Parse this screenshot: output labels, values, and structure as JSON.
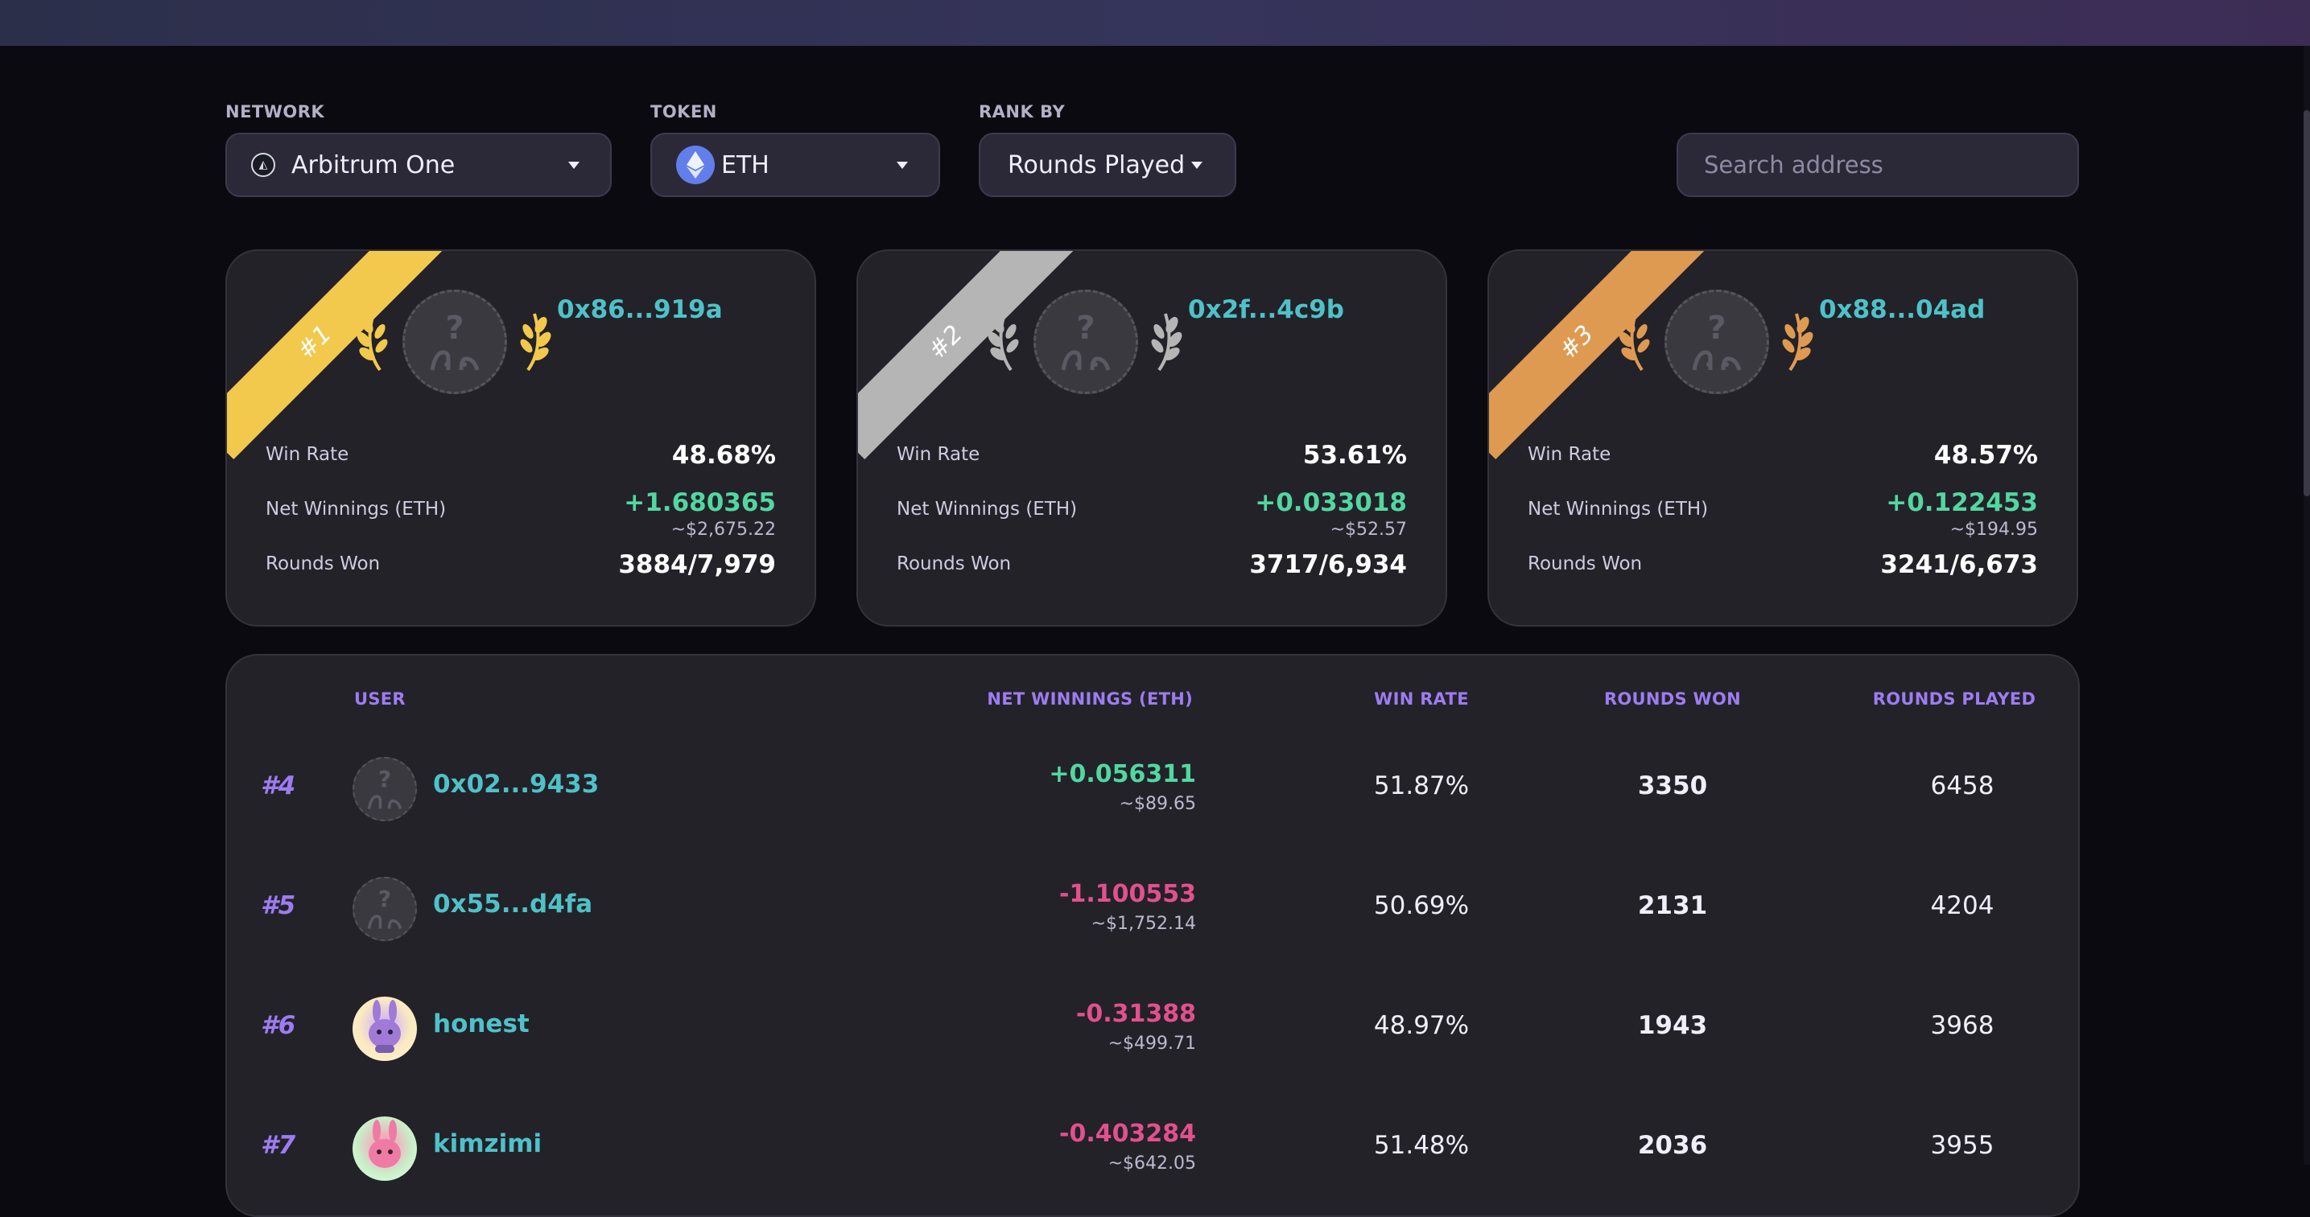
{
  "filters": {
    "network_label": "NETWORK",
    "network_value": "Arbitrum One",
    "token_label": "TOKEN",
    "token_value": "ETH",
    "rank_label": "RANK BY",
    "rank_value": "Rounds Played",
    "search_placeholder": "Search address"
  },
  "podium": [
    {
      "rank": "#1",
      "ribbon_color": "#f2c94c",
      "laurel_color": "#f2c94c",
      "address": "0x86...919a",
      "win_rate_label": "Win Rate",
      "win_rate": "48.68%",
      "net_label": "Net Winnings (ETH)",
      "net": "+1.680365",
      "net_usd": "~$2,675.22",
      "rounds_label": "Rounds Won",
      "rounds": "3884/7,979"
    },
    {
      "rank": "#2",
      "ribbon_color": "#b5b5b5",
      "laurel_color": "#b5b5b5",
      "address": "0x2f...4c9b",
      "win_rate_label": "Win Rate",
      "win_rate": "53.61%",
      "net_label": "Net Winnings (ETH)",
      "net": "+0.033018",
      "net_usd": "~$52.57",
      "rounds_label": "Rounds Won",
      "rounds": "3717/6,934"
    },
    {
      "rank": "#3",
      "ribbon_color": "#df9a52",
      "laurel_color": "#df9a52",
      "address": "0x88...04ad",
      "win_rate_label": "Win Rate",
      "win_rate": "48.57%",
      "net_label": "Net Winnings (ETH)",
      "net": "+0.122453",
      "net_usd": "~$194.95",
      "rounds_label": "Rounds Won",
      "rounds": "3241/6,673"
    }
  ],
  "table": {
    "headers": {
      "user": "USER",
      "net": "NET WINNINGS (ETH)",
      "win_rate": "WIN RATE",
      "rounds_won": "ROUNDS WON",
      "rounds_played": "ROUNDS PLAYED"
    },
    "rows": [
      {
        "rank": "#4",
        "user": "0x02...9433",
        "avatar": "placeholder",
        "net": "+0.056311",
        "net_usd": "~$89.65",
        "sign": "pos",
        "win_rate": "51.87%",
        "rounds_won": "3350",
        "rounds_played": "6458"
      },
      {
        "rank": "#5",
        "user": "0x55...d4fa",
        "avatar": "placeholder",
        "net": "-1.100553",
        "net_usd": "~$1,752.14",
        "sign": "neg",
        "win_rate": "50.69%",
        "rounds_won": "2131",
        "rounds_played": "4204"
      },
      {
        "rank": "#6",
        "user": "honest",
        "avatar": "img1",
        "net": "-0.31388",
        "net_usd": "~$499.71",
        "sign": "neg",
        "win_rate": "48.97%",
        "rounds_won": "1943",
        "rounds_played": "3968"
      },
      {
        "rank": "#7",
        "user": "kimzimi",
        "avatar": "img2",
        "net": "-0.403284",
        "net_usd": "~$642.05",
        "sign": "neg",
        "win_rate": "51.48%",
        "rounds_won": "2036",
        "rounds_played": "3955"
      }
    ]
  }
}
